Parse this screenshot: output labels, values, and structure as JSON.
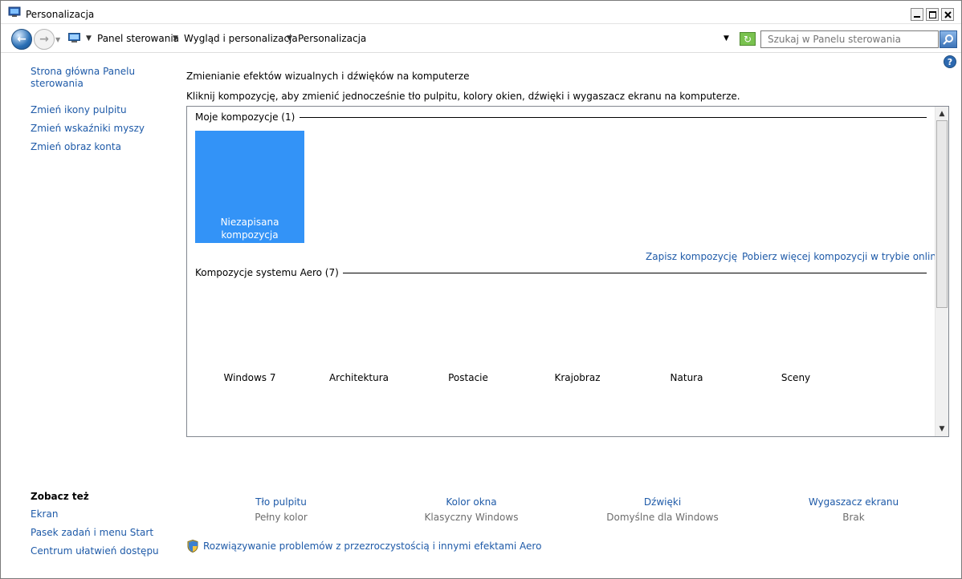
{
  "window": {
    "title": "Personalizacja"
  },
  "address": {
    "crumbs": [
      "Panel sterowania",
      "Wygląd i personalizacja",
      "Personalizacja"
    ],
    "search_placeholder": "Szukaj w Panelu sterowania"
  },
  "sidebar": {
    "home_line1": "Strona główna Panelu",
    "home_line2": "sterowania",
    "links": [
      "Zmień ikony pulpitu",
      "Zmień wskaźniki myszy",
      "Zmień obraz konta"
    ],
    "see_also_title": "Zobacz też",
    "see_also": [
      "Ekran",
      "Pasek zadań i menu Start",
      "Centrum ułatwień dostępu"
    ]
  },
  "main": {
    "title": "Zmienianie efektów wizualnych i dźwięków na komputerze",
    "description": "Kliknij kompozycję, aby zmienić jednocześnie tło pulpitu, kolory okien, dźwięki i wygaszacz ekranu na komputerze.",
    "my_themes_header": "Moje kompozycje (1)",
    "unsaved_theme_line1": "Niezapisana",
    "unsaved_theme_line2": "kompozycja",
    "save_theme": "Zapisz kompozycję",
    "get_more_online": "Pobierz więcej kompozycji w trybie online",
    "aero_header": "Kompozycje systemu Aero (7)",
    "aero_themes": [
      "Windows 7",
      "Architektura",
      "Postacie",
      "Krajobraz",
      "Natura",
      "Sceny"
    ]
  },
  "bottom": {
    "items": [
      {
        "label": "Tło pulpitu",
        "value": "Pełny kolor"
      },
      {
        "label": "Kolor okna",
        "value": "Klasyczny Windows"
      },
      {
        "label": "Dźwięki",
        "value": "Domyślne dla Windows"
      },
      {
        "label": "Wygaszacz ekranu",
        "value": "Brak"
      }
    ],
    "troubleshoot": "Rozwiązywanie problemów z przezroczystością i innymi efektami Aero"
  },
  "icons": [
    "window-app-icon",
    "back-arrow-icon",
    "forward-arrow-icon",
    "control-panel-icon",
    "refresh-icon",
    "search-icon",
    "help-icon",
    "shield-icon"
  ],
  "colors": {
    "link": "#1e5aa8",
    "selected_tile": "#3393f7"
  }
}
